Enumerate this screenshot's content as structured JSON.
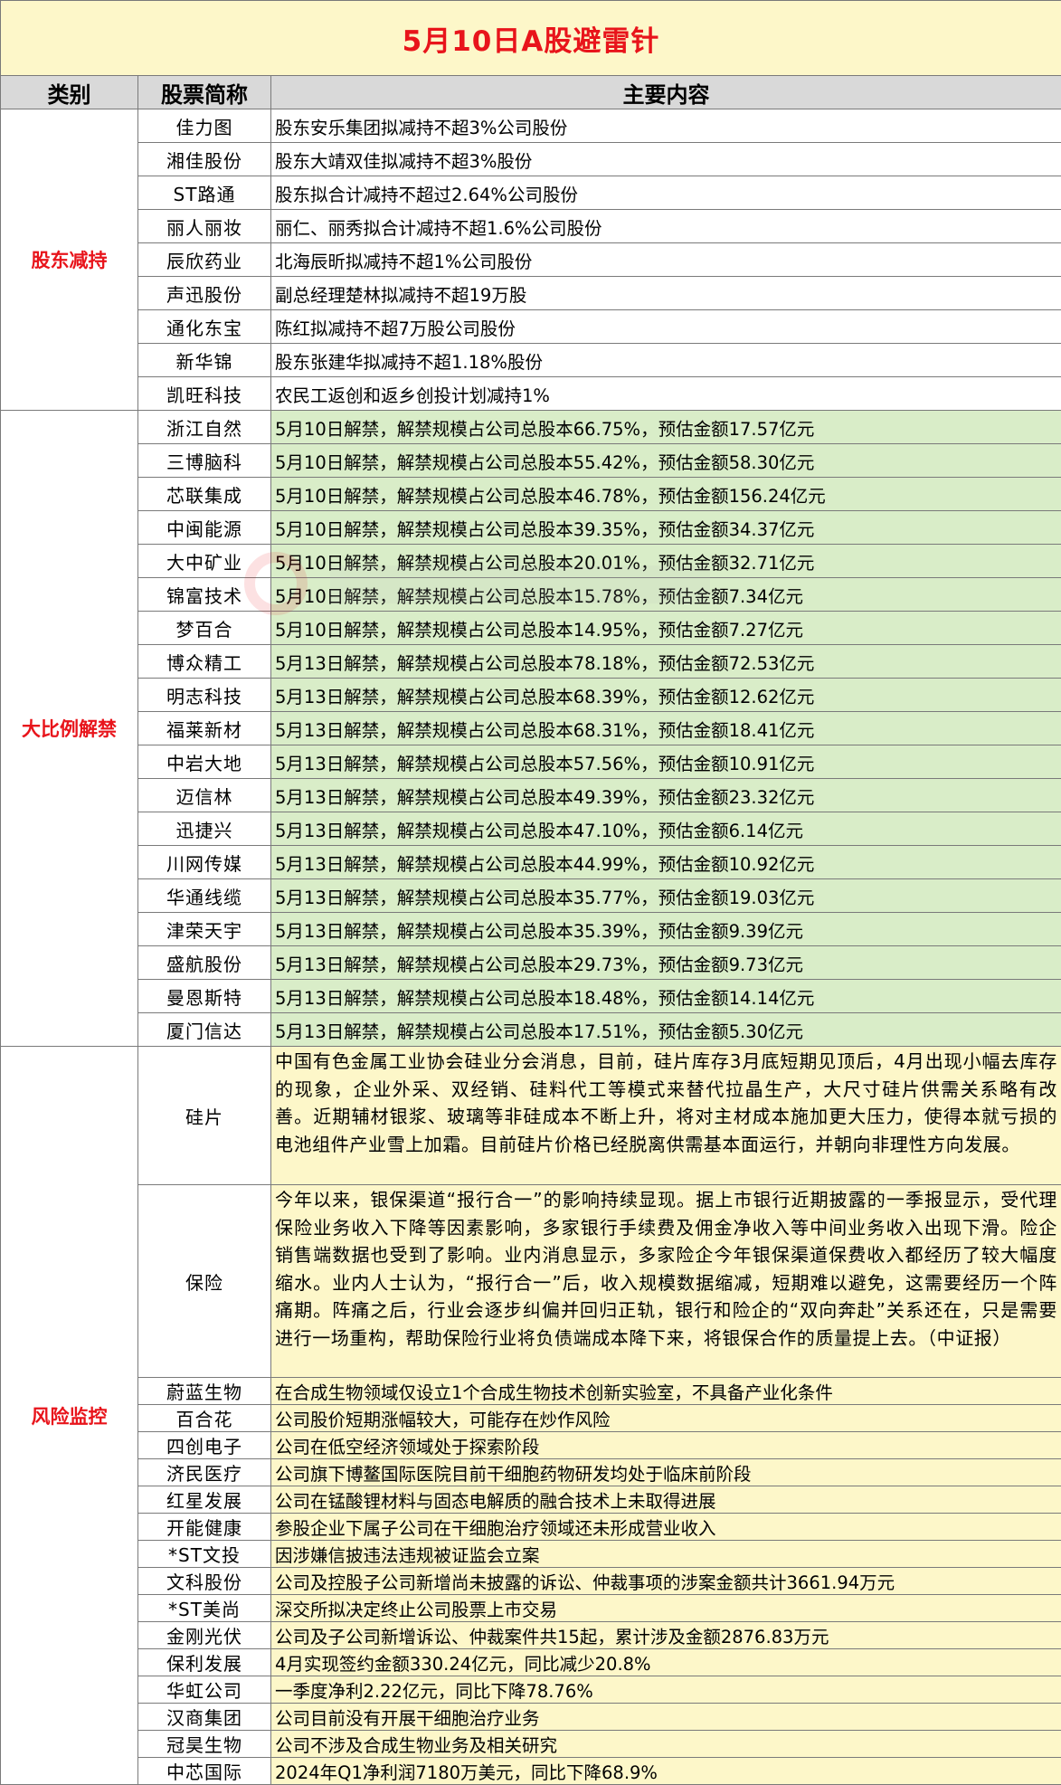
{
  "title": "5月10日A股避雷针",
  "headers": {
    "category": "类别",
    "stock": "股票简称",
    "content": "主要内容"
  },
  "colors": {
    "title_red": "#e8141b",
    "title_bg": "#fdf7c9",
    "header_bg": "#d9d9d9",
    "green_bg": "#d9edc8",
    "yellow_bg": "#fdf7c9"
  },
  "group1": {
    "category": "股东减持",
    "rows": [
      {
        "stock": "佳力图",
        "content": "股东安乐集团拟减持不超3%公司股份"
      },
      {
        "stock": "湘佳股份",
        "content": "股东大靖双佳拟减持不超3%股份"
      },
      {
        "stock": "ST路通",
        "content": "股东拟合计减持不超过2.64%公司股份"
      },
      {
        "stock": "丽人丽妆",
        "content": "丽仁、丽秀拟合计减持不超1.6%公司股份"
      },
      {
        "stock": "辰欣药业",
        "content": "北海辰昕拟减持不超1%公司股份"
      },
      {
        "stock": "声迅股份",
        "content": "副总经理楚林拟减持不超19万股"
      },
      {
        "stock": "通化东宝",
        "content": "陈红拟减持不超7万股公司股份"
      },
      {
        "stock": "新华锦",
        "content": "股东张建华拟减持不超1.18%股份"
      },
      {
        "stock": "凯旺科技",
        "content": "农民工返创和返乡创投计划减持1%"
      }
    ]
  },
  "group2": {
    "category": "大比例解禁",
    "rows": [
      {
        "stock": "浙江自然",
        "content": "5月10日解禁，解禁规模占公司总股本66.75%，预估金额17.57亿元"
      },
      {
        "stock": "三博脑科",
        "content": "5月10日解禁，解禁规模占公司总股本55.42%，预估金额58.30亿元"
      },
      {
        "stock": "芯联集成",
        "content": "5月10日解禁，解禁规模占公司总股本46.78%，预估金额156.24亿元"
      },
      {
        "stock": "中闽能源",
        "content": "5月10日解禁，解禁规模占公司总股本39.35%，预估金额34.37亿元"
      },
      {
        "stock": "大中矿业",
        "content": "5月10日解禁，解禁规模占公司总股本20.01%，预估金额32.71亿元"
      },
      {
        "stock": "锦富技术",
        "content": "5月10日解禁，解禁规模占公司总股本15.78%，预估金额7.34亿元"
      },
      {
        "stock": "梦百合",
        "content": "5月10日解禁，解禁规模占公司总股本14.95%，预估金额7.27亿元"
      },
      {
        "stock": "博众精工",
        "content": "5月13日解禁，解禁规模占公司总股本78.18%，预估金额72.53亿元"
      },
      {
        "stock": "明志科技",
        "content": "5月13日解禁，解禁规模占公司总股本68.39%，预估金额12.62亿元"
      },
      {
        "stock": "福莱新材",
        "content": "5月13日解禁，解禁规模占公司总股本68.31%，预估金额18.41亿元"
      },
      {
        "stock": "中岩大地",
        "content": "5月13日解禁，解禁规模占公司总股本57.56%，预估金额10.91亿元"
      },
      {
        "stock": "迈信林",
        "content": "5月13日解禁，解禁规模占公司总股本49.39%，预估金额23.32亿元"
      },
      {
        "stock": "迅捷兴",
        "content": "5月13日解禁，解禁规模占公司总股本47.10%，预估金额6.14亿元"
      },
      {
        "stock": "川网传媒",
        "content": "5月13日解禁，解禁规模占公司总股本44.99%，预估金额10.92亿元"
      },
      {
        "stock": "华通线缆",
        "content": "5月13日解禁，解禁规模占公司总股本35.77%，预估金额19.03亿元"
      },
      {
        "stock": "津荣天宇",
        "content": "5月13日解禁，解禁规模占公司总股本35.39%，预估金额9.39亿元"
      },
      {
        "stock": "盛航股份",
        "content": "5月13日解禁，解禁规模占公司总股本29.73%，预估金额9.73亿元"
      },
      {
        "stock": "曼恩斯特",
        "content": "5月13日解禁，解禁规模占公司总股本18.48%，预估金额14.14亿元"
      },
      {
        "stock": "厦门信达",
        "content": "5月13日解禁，解禁规模占公司总股本17.51%，预估金额5.30亿元"
      }
    ]
  },
  "group3": {
    "category": "风险监控",
    "para_rows": [
      {
        "stock": "硅片",
        "content": "中国有色金属工业协会硅业分会消息，目前，硅片库存3月底短期见顶后，4月出现小幅去库存的现象，企业外采、双经销、硅料代工等模式来替代拉晶生产，大尺寸硅片供需关系略有改善。近期辅材银浆、玻璃等非硅成本不断上升，将对主材成本施加更大压力，使得本就亏损的电池组件产业雪上加霜。目前硅片价格已经脱离供需基本面运行，并朝向非理性方向发展。"
      },
      {
        "stock": "保险",
        "content": "今年以来，银保渠道“报行合一”的影响持续显现。据上市银行近期披露的一季报显示，受代理保险业务收入下降等因素影响，多家银行手续费及佣金净收入等中间业务收入出现下滑。险企销售端数据也受到了影响。业内消息显示，多家险企今年银保渠道保费收入都经历了较大幅度缩水。业内人士认为，“报行合一”后，收入规模数据缩减，短期难以避免，这需要经历一个阵痛期。阵痛之后，行业会逐步纠偏并回归正轨，银行和险企的“双向奔赴”关系还在，只是需要进行一场重构，帮助保险行业将负债端成本降下来，将银保合作的质量提上去。（中证报）"
      }
    ],
    "rows": [
      {
        "stock": "蔚蓝生物",
        "content": "在合成生物领域仅设立1个合成生物技术创新实验室，不具备产业化条件"
      },
      {
        "stock": "百合花",
        "content": "公司股价短期涨幅较大，可能存在炒作风险"
      },
      {
        "stock": "四创电子",
        "content": "公司在低空经济领域处于探索阶段"
      },
      {
        "stock": "济民医疗",
        "content": "公司旗下博鳌国际医院目前干细胞药物研发均处于临床前阶段"
      },
      {
        "stock": "红星发展",
        "content": "公司在锰酸锂材料与固态电解质的融合技术上未取得进展"
      },
      {
        "stock": "开能健康",
        "content": "参股企业下属子公司在干细胞治疗领域还未形成营业收入"
      },
      {
        "stock": "*ST文投",
        "content": "因涉嫌信披违法违规被证监会立案"
      },
      {
        "stock": "文科股份",
        "content": "公司及控股子公司新增尚未披露的诉讼、仲裁事项的涉案金额共计3661.94万元"
      },
      {
        "stock": "*ST美尚",
        "content": "深交所拟决定终止公司股票上市交易"
      },
      {
        "stock": "金刚光伏",
        "content": "公司及子公司新增诉讼、仲裁案件共15起，累计涉及金额2876.83万元"
      },
      {
        "stock": "保利发展",
        "content": "4月实现签约金额330.24亿元，同比减少20.8%"
      },
      {
        "stock": "华虹公司",
        "content": "一季度净利2.22亿元，同比下降78.76%"
      },
      {
        "stock": "汉商集团",
        "content": "公司目前没有开展干细胞治疗业务"
      },
      {
        "stock": "冠昊生物",
        "content": "公司不涉及合成生物业务及相关研究"
      },
      {
        "stock": "中芯国际",
        "content": "2024年Q1净利润7180万美元，同比下降68.9%"
      }
    ]
  }
}
